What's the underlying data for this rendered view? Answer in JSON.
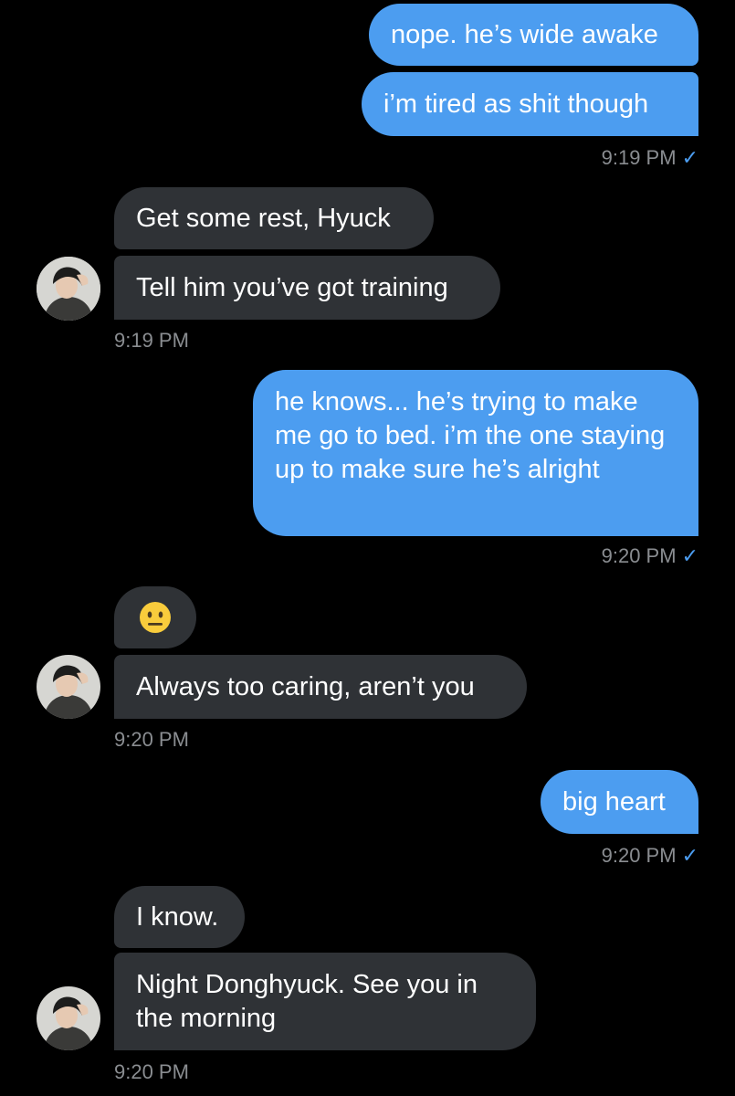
{
  "conversation": {
    "messages": [
      {
        "text": "nope. he’s wide awake"
      },
      {
        "text": "i’m tired as shit though"
      },
      {
        "text": "Get some rest, Hyuck"
      },
      {
        "text": "Tell him you’ve got training"
      },
      {
        "text": "he knows... he’s trying to make me go to bed. i’m the one staying up to make sure he’s alright"
      },
      {
        "text": "",
        "emoji": "neutral-face-emoji"
      },
      {
        "text": "Always too caring, aren’t you"
      },
      {
        "text": "big heart"
      },
      {
        "text": "I know."
      },
      {
        "text": "Night Donghyuck. See you in the morning"
      }
    ],
    "timestamps": [
      "9:19 PM",
      "9:19 PM",
      "9:20 PM",
      "9:20 PM",
      "9:20 PM",
      "9:20 PM"
    ],
    "read_check": "✓"
  },
  "colors": {
    "background": "#000000",
    "sent_bubble": "#4c9df0",
    "received_bubble": "#2f3236",
    "timestamp": "#8a8d91",
    "check": "#4c9df0"
  }
}
